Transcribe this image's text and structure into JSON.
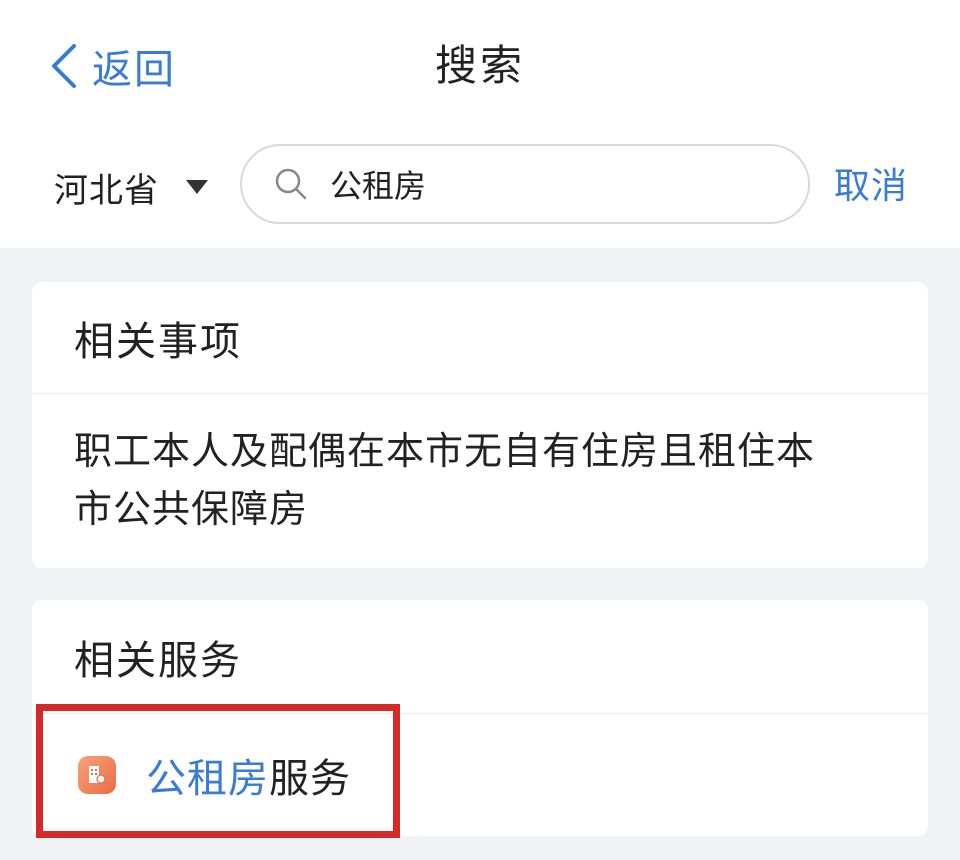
{
  "nav": {
    "back_label": "返回",
    "title": "搜索"
  },
  "search": {
    "region": "河北省",
    "query": "公租房",
    "cancel_label": "取消"
  },
  "related_items": {
    "heading": "相关事项",
    "items": [
      {
        "text": "职工本人及配偶在本市无自有住房且租住本市公共保障房"
      }
    ]
  },
  "related_services": {
    "heading": "相关服务",
    "items": [
      {
        "label_highlight": "公租房",
        "label_rest": "服务",
        "icon": "building-icon"
      }
    ]
  },
  "colors": {
    "accent": "#3a7bd5",
    "annotation": "#d62a2a",
    "icon_bg": "#ea6c44"
  }
}
